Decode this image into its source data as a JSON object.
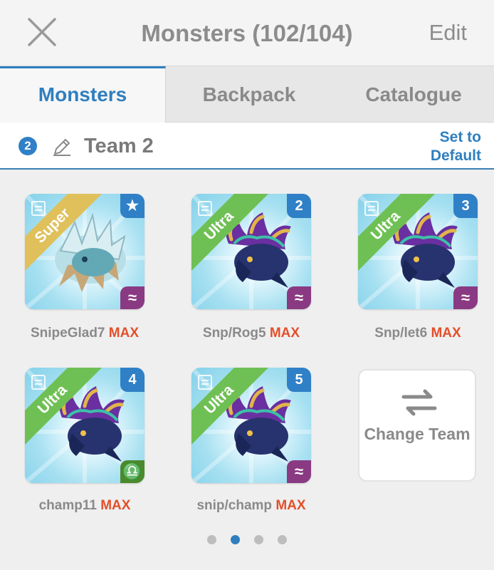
{
  "header": {
    "title": "Monsters (102/104)",
    "edit_label": "Edit"
  },
  "tabs": [
    {
      "label": "Monsters",
      "active": true
    },
    {
      "label": "Backpack",
      "active": false
    },
    {
      "label": "Catalogue",
      "active": false
    }
  ],
  "team": {
    "number": "2",
    "name": "Team 2",
    "set_default_label": "Set to Default"
  },
  "monsters": [
    {
      "name": "SnipeGlad7",
      "level": "MAX",
      "rank": "Super",
      "slot": "★",
      "element": "≈"
    },
    {
      "name": "Snp/Rog5",
      "level": "MAX",
      "rank": "Ultra",
      "slot": "2",
      "element": "≈"
    },
    {
      "name": "Snp/let6",
      "level": "MAX",
      "rank": "Ultra",
      "slot": "3",
      "element": "≈"
    },
    {
      "name": "champ11",
      "level": "MAX",
      "rank": "Ultra",
      "slot": "4",
      "element": "♎"
    },
    {
      "name": "snip/champ",
      "level": "MAX",
      "rank": "Ultra",
      "slot": "5",
      "element": "≈"
    }
  ],
  "change_team": {
    "label": "Change Team",
    "icon": "swap-arrows-icon"
  },
  "pager": {
    "pages": 4,
    "current": 2
  },
  "colors": {
    "accent": "#2f7fbf",
    "max": "#e2502a",
    "super_ribbon": "#e0c05a",
    "ultra_ribbon": "#6fc054",
    "water_element": "#8a3a82",
    "earth_element": "#4a8a2c"
  }
}
